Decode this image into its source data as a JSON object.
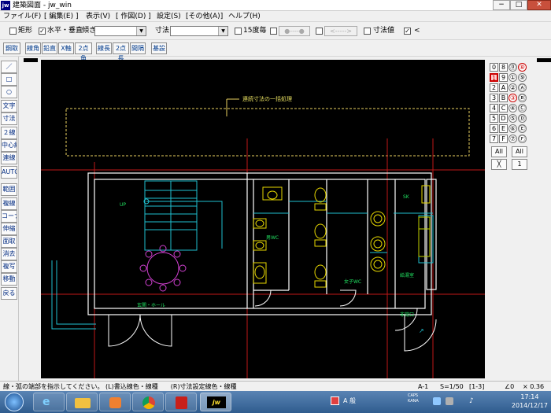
{
  "window": {
    "title": "建築図面 - jw_win",
    "app_icon": "jw",
    "minimize": "−",
    "maximize": "□",
    "close": "✕"
  },
  "menu": [
    "ファイル(F)",
    "[ 編集(E) ]",
    "表示(V)",
    "[ 作図(D) ]",
    "設定(S)",
    "[その他(A)]",
    "ヘルプ(H)"
  ],
  "toolbar1": {
    "rect_label": "矩形",
    "rect_checked": false,
    "hv_label": "水平・垂直",
    "hv_checked": true,
    "tilt_label": "傾き",
    "tilt_value": "",
    "dim_label": "寸法",
    "dim_value": "",
    "deg15_label": "15度毎",
    "deg15_checked": false,
    "dot_btn": "●----●",
    "arrow_btn": "<----->",
    "dimval_label": "寸法値",
    "dimval_checked": false,
    "lt_label": "<",
    "lt_checked": true
  },
  "toolbar2": [
    "鋼取",
    "線角",
    "鉛直",
    "X軸",
    "2点角",
    "線長",
    "2点長",
    "間隔",
    "基設"
  ],
  "left_tools": [
    "／",
    "□",
    "○",
    "文字",
    "寸法",
    "２線",
    "中心線",
    "連線",
    "AUTO",
    "範囲",
    "複線",
    "コーナー",
    "伸縮",
    "面取",
    "消去",
    "複写",
    "移動",
    "戻る"
  ],
  "layers": {
    "rows": [
      [
        "0",
        "8",
        "⓪",
        "⑧"
      ],
      [
        "1",
        "9",
        "①",
        "⑨"
      ],
      [
        "2",
        "A",
        "②",
        "Ⓐ"
      ],
      [
        "3",
        "B",
        "③",
        "Ⓑ"
      ],
      [
        "4",
        "C",
        "④",
        "Ⓒ"
      ],
      [
        "5",
        "D",
        "⑤",
        "Ⓓ"
      ],
      [
        "6",
        "E",
        "⑥",
        "Ⓔ"
      ],
      [
        "7",
        "F",
        "⑦",
        "Ⓕ"
      ]
    ],
    "all1": "All",
    "all2": "All",
    "x_btn": "╳",
    "one_btn": "1"
  },
  "drawing": {
    "annotation": "連続寸法の一括処理",
    "up_label": "UP",
    "hall_label": "玄関・ホール",
    "mens_wc": "男WC",
    "womens_wc": "女子WC",
    "sk_label": "SK",
    "kitchen_label": "給湯室",
    "door_label": "非常口"
  },
  "status": {
    "message": "線・弧の端部を指示してください。 (L)書込線色・線種　　(R)寸法設定線色・線種",
    "layer": "A-1",
    "scale": "S=1/50",
    "group": "[1-3]",
    "angle": "∠0",
    "zoom": "× 0.36"
  },
  "taskbar": {
    "time": "17:14",
    "date": "2014/12/17",
    "ime": "A 般",
    "caps": "CAPS",
    "kana": "KANA"
  }
}
